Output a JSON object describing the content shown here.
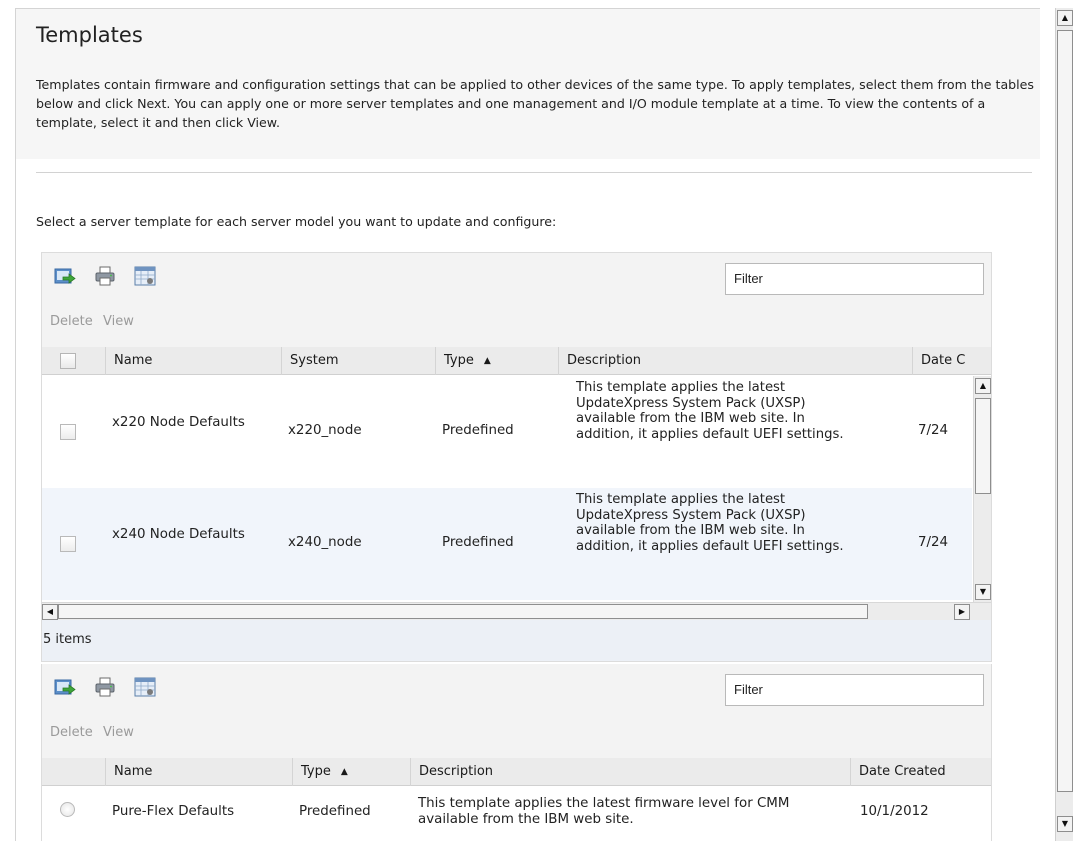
{
  "page": {
    "title": "Templates",
    "intro": "Templates contain firmware and configuration settings that can be applied to other devices of the same type. To apply templates, select them from the tables below and click Next. You can apply one or more server templates and one management and I/O module template at a time. To view the contents of a template, select it and then click View.",
    "instruction": "Select a server template for each server model you want to update and configure:"
  },
  "server_table": {
    "toolbar": {
      "icons": [
        "export-icon",
        "print-icon",
        "table-settings-icon"
      ],
      "filter_placeholder": "Filter",
      "actions": {
        "delete": "Delete",
        "view": "View"
      }
    },
    "columns": {
      "name": "Name",
      "system": "System",
      "type": "Type",
      "description": "Description",
      "date_created": "Date C"
    },
    "sort_indicator": "▲",
    "rows": [
      {
        "name": "x220 Node Defaults",
        "system": "x220_node",
        "type": "Predefined",
        "description": "This template applies the latest UpdateXpress System Pack (UXSP) available from the IBM web site. In addition, it applies default UEFI settings.",
        "date_created": "7/24"
      },
      {
        "name": "x240 Node Defaults",
        "system": "x240_node",
        "type": "Predefined",
        "description": "This template applies the latest UpdateXpress System Pack (UXSP) available from the IBM web site. In addition, it applies default UEFI settings.",
        "date_created": "7/24"
      }
    ],
    "footer": "5 items"
  },
  "cmm_table": {
    "toolbar": {
      "icons": [
        "export-icon",
        "print-icon",
        "table-settings-icon"
      ],
      "filter_placeholder": "Filter",
      "actions": {
        "delete": "Delete",
        "view": "View"
      }
    },
    "columns": {
      "name": "Name",
      "type": "Type",
      "description": "Description",
      "date_created": "Date Created"
    },
    "sort_indicator": "▲",
    "rows": [
      {
        "name": "Pure-Flex Defaults",
        "type": "Predefined",
        "description": "This template applies the latest firmware level for CMM available from the IBM web site.",
        "date_created": "10/1/2012"
      }
    ]
  },
  "colors": {
    "header_bg": "#f6f6f6",
    "toolbar_bg": "#f3f3f3",
    "row_alt_bg": "#f1f5fb",
    "disabled_text": "#9a9a9a"
  }
}
